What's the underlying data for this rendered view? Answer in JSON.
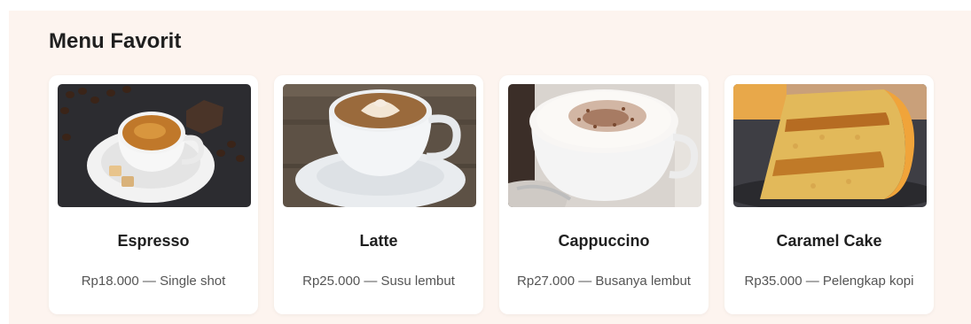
{
  "section": {
    "title": "Menu Favorit"
  },
  "menu": [
    {
      "name": "Espresso",
      "description": "Rp18.000 — Single shot",
      "image": "espresso-cup-image"
    },
    {
      "name": "Latte",
      "description": "Rp25.000 — Susu lembut",
      "image": "latte-art-cup-image"
    },
    {
      "name": "Cappuccino",
      "description": "Rp27.000 — Busanya lembut",
      "image": "cappuccino-cup-image"
    },
    {
      "name": "Caramel Cake",
      "description": "Rp35.000 — Pelengkap kopi",
      "image": "caramel-cake-slice-image"
    }
  ],
  "colors": {
    "section_bg": "#fdf4ef",
    "card_bg": "#ffffff",
    "title": "#1f1f1f",
    "text": "#555555"
  }
}
